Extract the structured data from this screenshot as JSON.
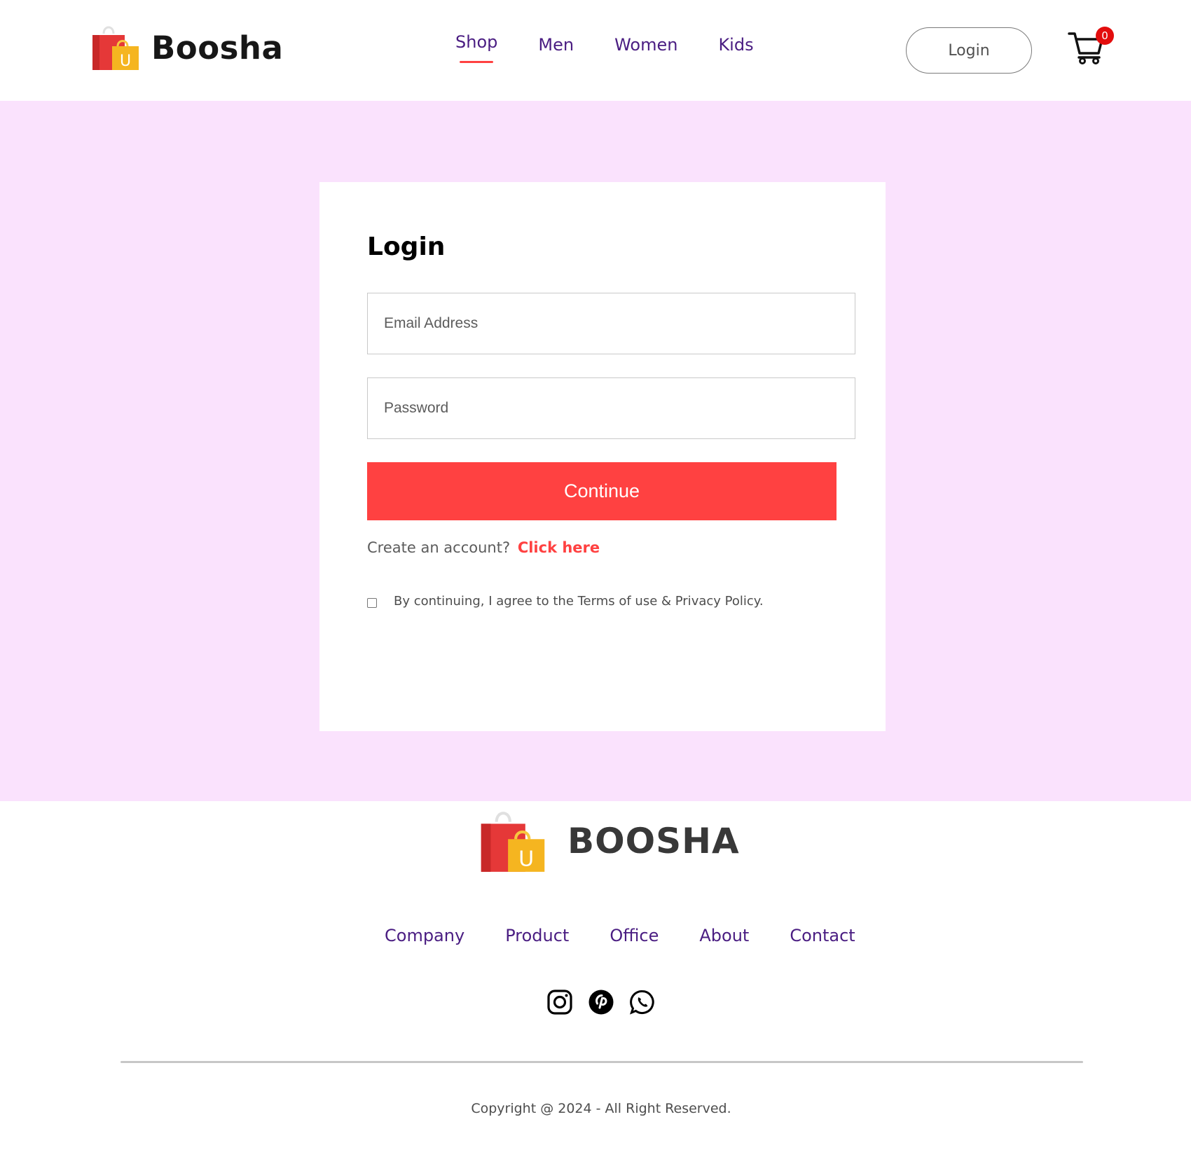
{
  "header": {
    "brand": "Boosha",
    "nav": [
      {
        "label": "Shop",
        "active": true
      },
      {
        "label": "Men",
        "active": false
      },
      {
        "label": "Women",
        "active": false
      },
      {
        "label": "Kids",
        "active": false
      }
    ],
    "login_label": "Login",
    "cart_count": "0"
  },
  "login_card": {
    "title": "Login",
    "email_placeholder": "Email Address",
    "password_placeholder": "Password",
    "continue_label": "Continue",
    "create_prompt": "Create an account?",
    "create_link": "Click here",
    "agree_text": "By continuing, I agree to the Terms of use & Privacy Policy."
  },
  "footer": {
    "brand": "BOOSHA",
    "links": [
      "Company",
      "Product",
      "Office",
      "About",
      "Contact"
    ],
    "socials": [
      "instagram-icon",
      "pinterest-icon",
      "whatsapp-icon"
    ],
    "copyright": "Copyright @ 2024 - All Right Reserved."
  },
  "colors": {
    "accent": "#ff4141",
    "nav_text": "#4a1d82",
    "page_bg": "#fae2fd",
    "cart_badge": "#e30d0d"
  }
}
